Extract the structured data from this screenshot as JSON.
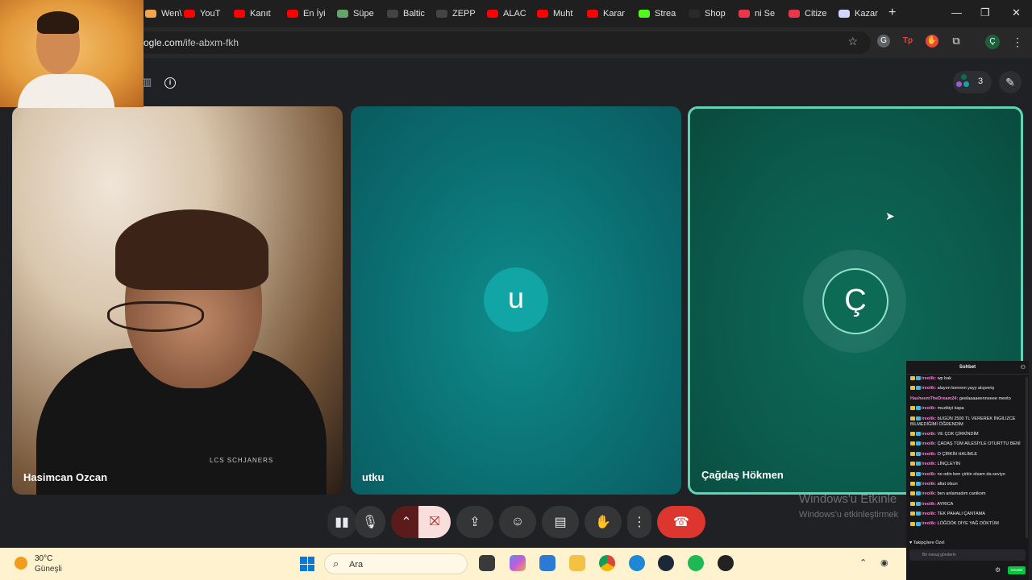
{
  "browser": {
    "tabs": [
      {
        "label": "Wen\\",
        "color": "#f0a64a"
      },
      {
        "label": "YouT",
        "color": "#ff0000"
      },
      {
        "label": "Kanıt",
        "color": "#ff0000"
      },
      {
        "label": "En İyi",
        "color": "#ff0000"
      },
      {
        "label": "Süpe",
        "color": "#66a36a"
      },
      {
        "label": "Baltic",
        "color": "#444444"
      },
      {
        "label": "ZEPP",
        "color": "#444444"
      },
      {
        "label": "ALAC",
        "color": "#ff0000"
      },
      {
        "label": "Muht",
        "color": "#ff0000"
      },
      {
        "label": "Karar",
        "color": "#ff0000"
      },
      {
        "label": "Strea",
        "color": "#53fc18"
      },
      {
        "label": "Shop",
        "color": "#2a2a2a"
      },
      {
        "label": "ni Se",
        "color": "#e8374a"
      },
      {
        "label": "Citize",
        "color": "#e8374a"
      },
      {
        "label": "Kazar",
        "color": "#d0d8ff"
      }
    ],
    "new_tab": "+",
    "minimize": "—",
    "maximize": "❐",
    "close": "✕",
    "url_host": "ogle.com",
    "url_path": "/ife-abxm-fkh",
    "profile_initial": "Ç"
  },
  "meet": {
    "participant_count": "3",
    "tiles": [
      {
        "name": "Hasimcan Ozcan",
        "shirt_text": "LCS SCHJANERS"
      },
      {
        "name": "utku",
        "avatar": "u"
      },
      {
        "name": "Çağdaş Hökmen",
        "avatar": "Ç"
      }
    ],
    "watermark_title": "Windows'u Etkinle",
    "watermark_sub": "Windows'u etkinleştirmek"
  },
  "chat": {
    "title": "Sohbet",
    "messages": [
      {
        "user": "ireolik:",
        "text": "wp bak"
      },
      {
        "user": "ireolik:",
        "text": "alayım bennnn yayy alışveriş"
      },
      {
        "user": "HasheemTheDream24:",
        "text": "geelaaaaeenneeee meeto"
      },
      {
        "user": "ireolik:",
        "text": "muzikiyi kapa"
      },
      {
        "user": "ireolik:",
        "text": "bUGÜN 2500 TL VEREREK İNGİLİZCE BİLMEDİĞİMİ ÖĞRENDİM"
      },
      {
        "user": "ireolik:",
        "text": "VE ÇOK ÇİRKİNDİM"
      },
      {
        "user": "ireolik:",
        "text": "ÇADAŞ TÜM AİLESİYLE OTURTTU BENİ"
      },
      {
        "user": "ireolik:",
        "text": "O ÇİRKİN HALİMLE"
      },
      {
        "user": "ireolik:",
        "text": "LİNÇLEYİN"
      },
      {
        "user": "ireolik:",
        "text": "no odin ben çirkin olsam da seviyo"
      },
      {
        "user": "ireolik:",
        "text": "afiat olsun"
      },
      {
        "user": "ireolik:",
        "text": "ben anlamadım canikom"
      },
      {
        "user": "ireolik:",
        "text": "AYRICA"
      },
      {
        "user": "ireolik:",
        "text": "TEK PAHALI ÇANTAMA"
      },
      {
        "user": "ireolik:",
        "text": "LÖĞÖÖK DİYE YAĞ DÖKTÜM"
      }
    ],
    "footer_label": "♥ Takipçilere Özel",
    "input_placeholder": "Bir mesaj gönderin",
    "send_label": "Gönder"
  },
  "taskbar": {
    "temperature": "30°C",
    "condition": "Güneşli",
    "search_placeholder": "Ara"
  },
  "colors": {
    "meet_bg": "#202124",
    "end_call": "#dc362e",
    "speaking_border": "#5fd3b3",
    "tile_utku": "#0b6f72",
    "tile_cagdas": "#0b5a4b"
  }
}
